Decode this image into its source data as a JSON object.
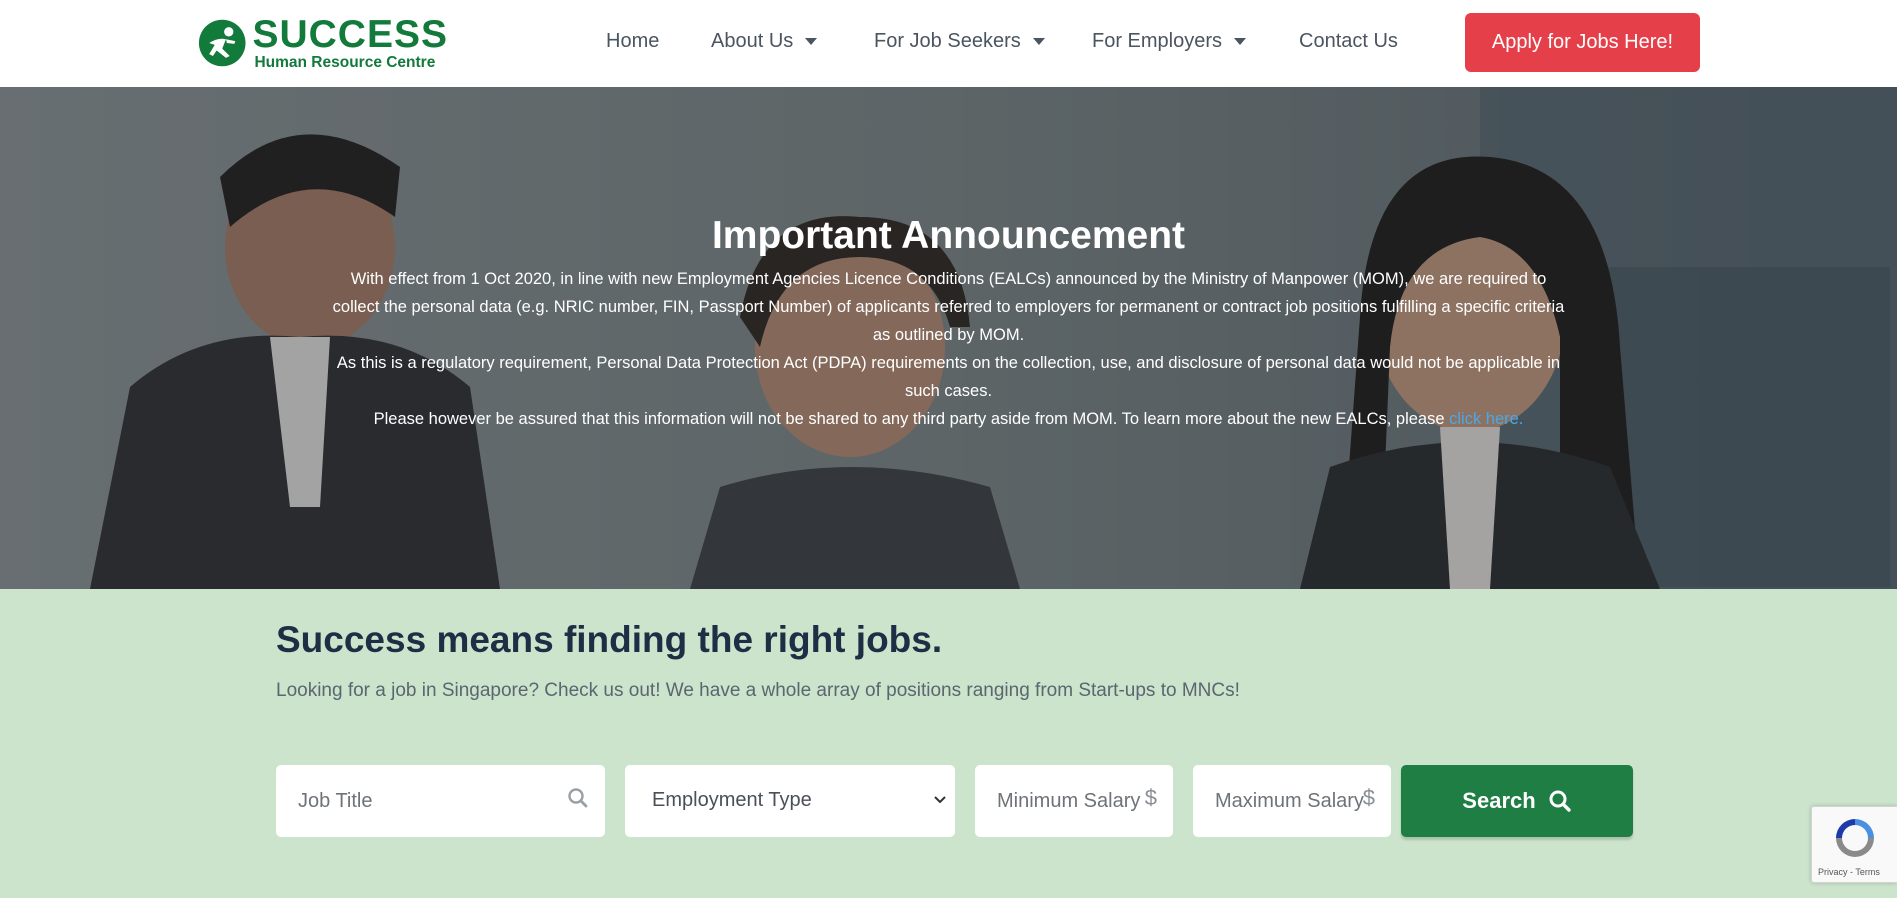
{
  "header": {
    "logo": {
      "name": "SUCCESS",
      "tagline": "Human Resource Centre"
    },
    "nav": [
      {
        "label": "Home",
        "has_dropdown": false
      },
      {
        "label": "About Us",
        "has_dropdown": true
      },
      {
        "label": "For Job Seekers",
        "has_dropdown": true
      },
      {
        "label": "For Employers",
        "has_dropdown": true
      },
      {
        "label": "Contact Us",
        "has_dropdown": false
      }
    ],
    "cta_label": "Apply for Jobs Here!"
  },
  "hero": {
    "title": "Important Announcement",
    "paragraph_1": "With effect from 1 Oct 2020, in line with new Employment Agencies Licence Conditions (EALCs) announced by the Ministry of Manpower (MOM), we are required to collect the personal data (e.g. NRIC number, FIN, Passport Number) of applicants referred to employers for permanent or contract job positions fulfilling a specific criteria as outlined by MOM.",
    "paragraph_2": "As this is a regulatory requirement, Personal Data Protection Act (PDPA) requirements on the collection, use, and disclosure of personal data would not be applicable in such cases.",
    "paragraph_3": "Please however be assured that this information will not be shared to any third party aside from MOM. To learn more about the new EALCs, please ",
    "link_text": "click here."
  },
  "search": {
    "title": "Success means finding the right jobs.",
    "subtitle": "Looking for a job in Singapore?  Check us out! We have a whole array of positions ranging from Start-ups to MNCs!",
    "job_title_placeholder": "Job Title",
    "employment_type_value": "Employment Type",
    "min_salary_placeholder": "Minimum Salary",
    "max_salary_placeholder": "Maximum Salary",
    "currency_symbol": "$",
    "button_label": "Search"
  },
  "recaptcha": {
    "links": "Privacy - Terms"
  },
  "colors": {
    "brand_green": "#127a3a",
    "cta_red": "#e5404a",
    "search_green": "#1e7e44",
    "section_bg": "#cbe4cb",
    "link_blue": "#4aa8e6"
  }
}
